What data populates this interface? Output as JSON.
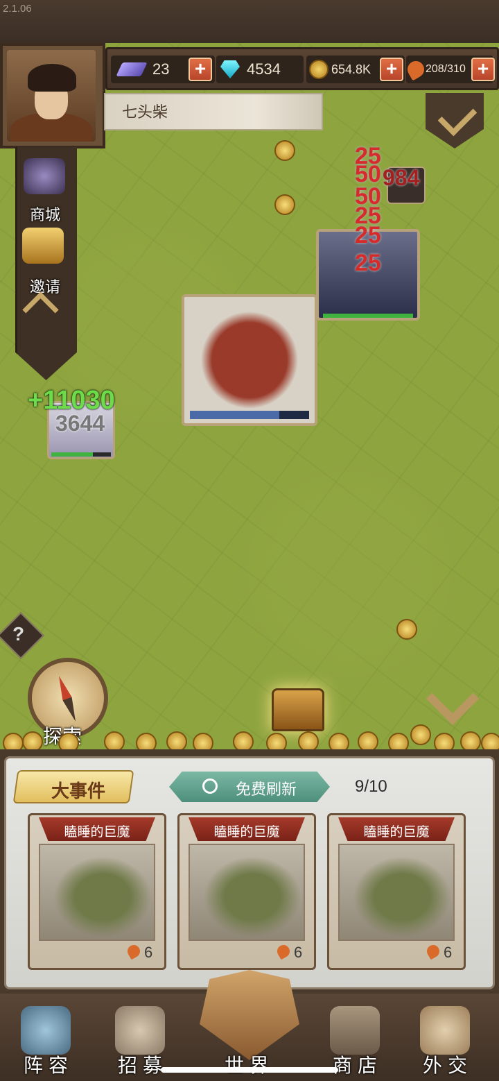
{
  "version": "2.1.06",
  "resources": {
    "crystal": "23",
    "diamond": "4534",
    "gold": "654.8K",
    "food": "208/310"
  },
  "location": "七头柴",
  "side_menu": [
    {
      "label": "商城",
      "icon": "pouch-icon"
    },
    {
      "label": "邀请",
      "icon": "treasure-chest-icon"
    }
  ],
  "map": {
    "heal_text": "+11030",
    "player_number": "3644",
    "damage_numbers": [
      "25",
      "50",
      "50",
      "25",
      "25",
      "25"
    ],
    "enemy_number": "984"
  },
  "explore_label": "探索",
  "events": {
    "tab_label": "大事件",
    "refresh_label": "免费刷新",
    "counter": "9/10",
    "cards": [
      {
        "title": "瞌睡的巨魔",
        "cost": "6"
      },
      {
        "title": "瞌睡的巨魔",
        "cost": "6"
      },
      {
        "title": "瞌睡的巨魔",
        "cost": "6"
      }
    ]
  },
  "nav": [
    {
      "label": "阵容",
      "icon": "helmet-icon"
    },
    {
      "label": "招募",
      "icon": "bell-icon"
    },
    {
      "label": "世界",
      "icon": "emblem-icon"
    },
    {
      "label": "商店",
      "icon": "crates-icon"
    },
    {
      "label": "外交",
      "icon": "handshake-icon"
    }
  ],
  "colors": {
    "map_green": "#8ea43f",
    "frame_brown": "#4a3a2c",
    "damage_red": "#d72b2b",
    "heal_green": "#6ddc4a"
  }
}
